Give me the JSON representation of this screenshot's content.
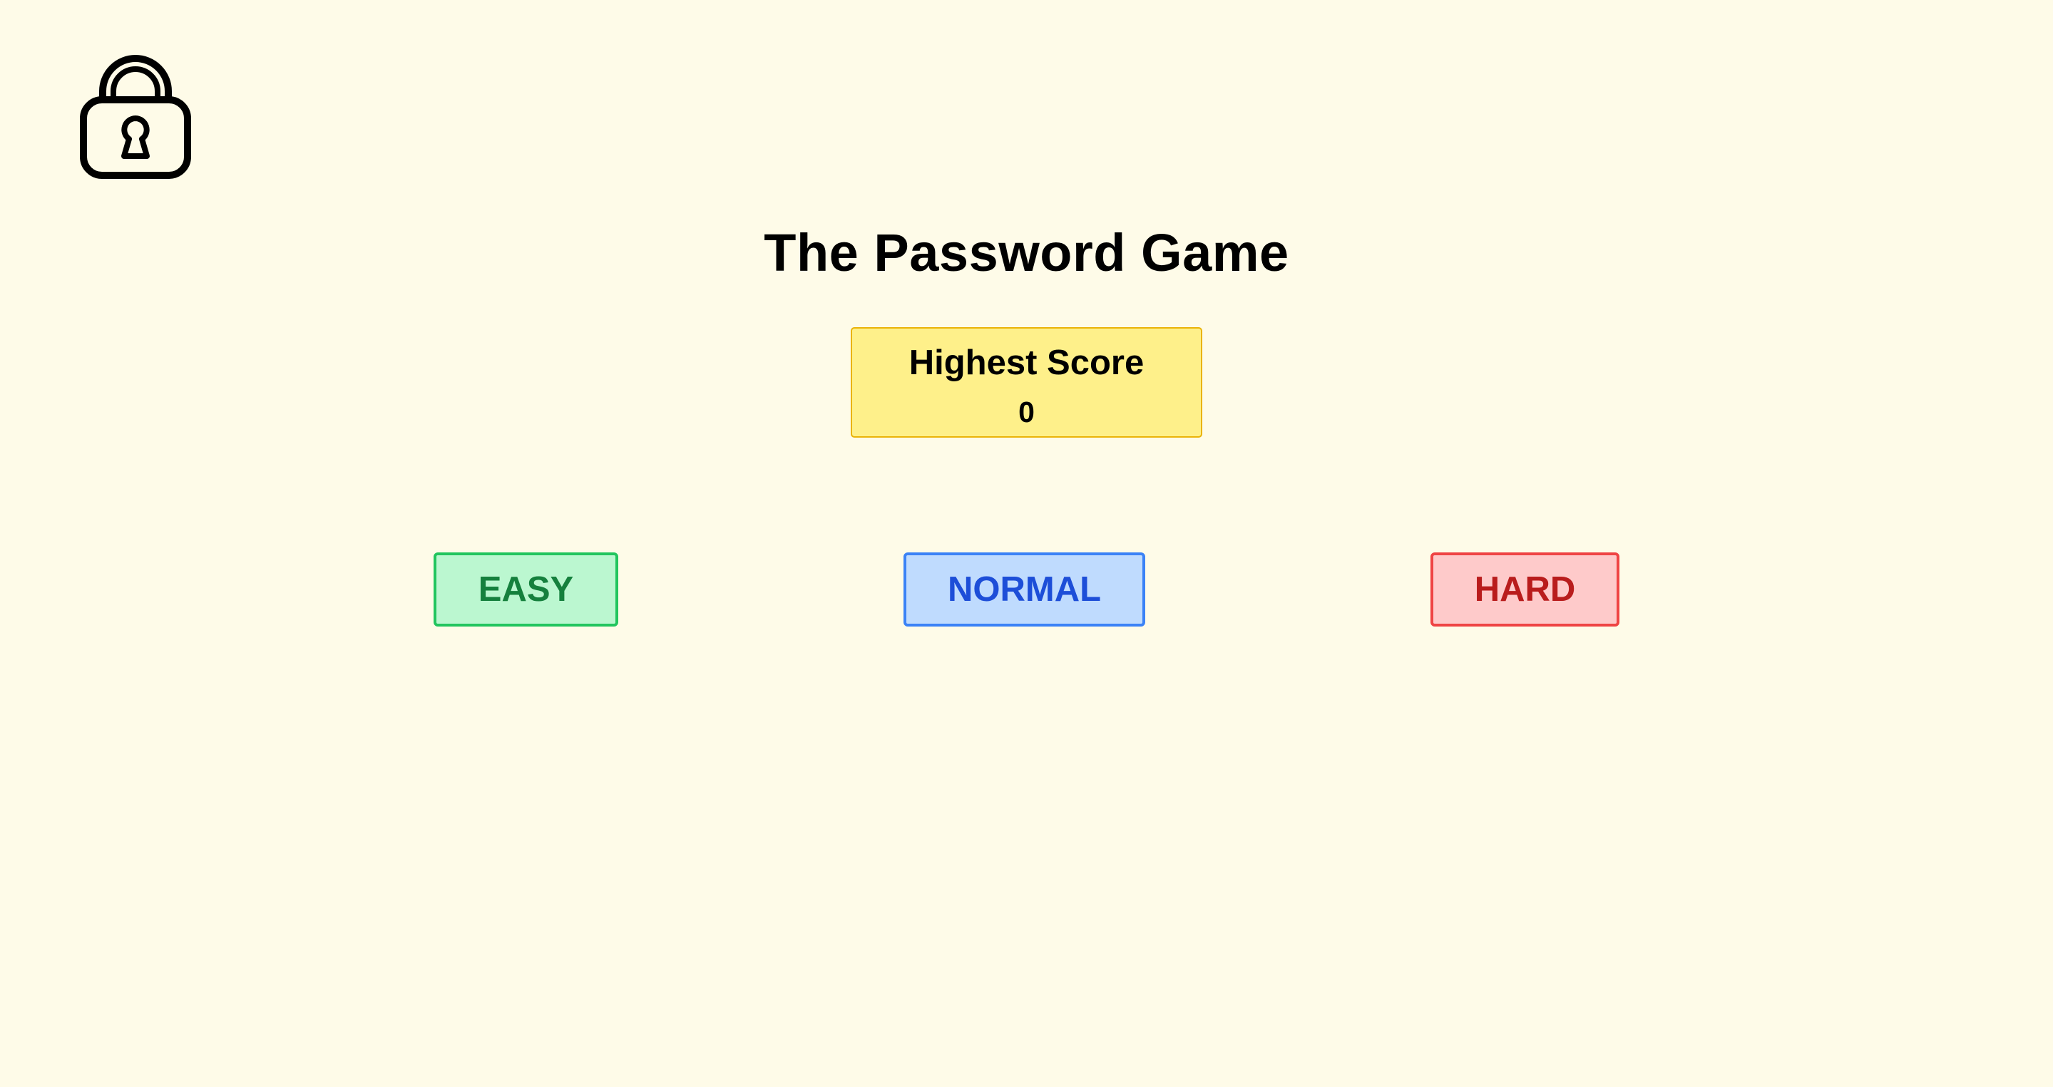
{
  "header": {
    "logo_icon": "lock-icon"
  },
  "game": {
    "title": "The Password Game"
  },
  "score": {
    "label": "Highest Score",
    "value": "0"
  },
  "modes": [
    {
      "id": "easy",
      "label": "EASY"
    },
    {
      "id": "normal",
      "label": "NORMAL"
    },
    {
      "id": "hard",
      "label": "HARD"
    }
  ],
  "colors": {
    "background": "#fefbe8",
    "score_bg": "#fef08a",
    "score_border": "#eab308",
    "easy_bg": "#bbf7d0",
    "easy_border": "#22c55e",
    "easy_text": "#15803d",
    "normal_bg": "#bfdbfe",
    "normal_border": "#3b82f6",
    "normal_text": "#1d4ed8",
    "hard_bg": "#fecaca",
    "hard_border": "#ef4444",
    "hard_text": "#b91c1c"
  }
}
